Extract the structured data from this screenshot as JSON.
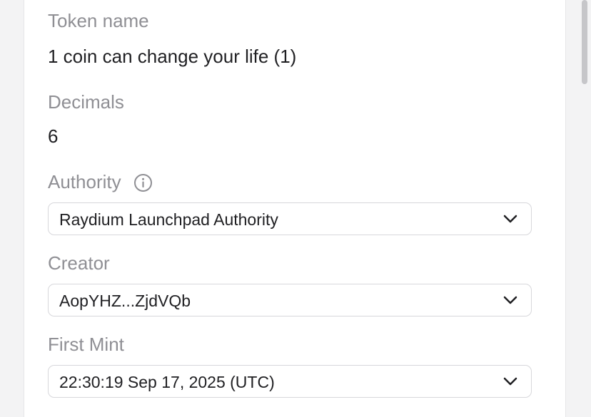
{
  "token": {
    "name_label": "Token name",
    "name_value": "1 coin can change your life (1)"
  },
  "decimals": {
    "label": "Decimals",
    "value": "6"
  },
  "authority": {
    "label": "Authority",
    "info_icon": "info-circle-icon",
    "selected": "Raydium Launchpad Authority"
  },
  "creator": {
    "label": "Creator",
    "selected": "AopYHZ...ZjdVQb"
  },
  "first_mint": {
    "label": "First Mint",
    "selected": "22:30:19 Sep 17, 2025 (UTC)"
  },
  "colors": {
    "label": "#8f8f94",
    "value": "#1f1f22",
    "border": "#d7d7db",
    "background": "#f3f3f4",
    "card": "#ffffff"
  }
}
